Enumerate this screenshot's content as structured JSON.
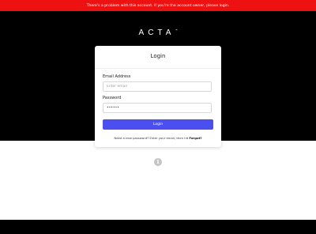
{
  "alert": {
    "message": "There's a problem with this account. If you're the account owner, please login."
  },
  "brand": {
    "logo_text": "ACTA",
    "logo_mark": "™"
  },
  "login": {
    "title": "Login",
    "email_label": "Email Address",
    "email_placeholder": "Enter email",
    "password_label": "Password",
    "password_value": "••••••",
    "button_label": "Login",
    "forgot_prompt": "Need a new password? Enter your email, then hit",
    "forgot_link": "Forgot?"
  },
  "icons": {
    "info": "info-icon",
    "info_glyph": "i"
  },
  "colors": {
    "alert_bg": "#ee1111",
    "hero_bg": "#000000",
    "button_bg": "#4b4ff0"
  }
}
